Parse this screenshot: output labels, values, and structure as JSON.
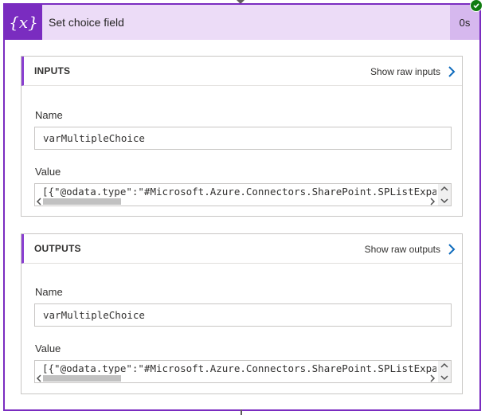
{
  "card": {
    "title": "Set choice field",
    "icon": "variable-icon",
    "icon_glyph": "{x}",
    "duration": "0s",
    "status": "succeeded"
  },
  "inputs": {
    "title": "INPUTS",
    "raw_link": "Show raw inputs",
    "name_label": "Name",
    "name_value": "varMultipleChoice",
    "value_label": "Value",
    "value_text": "[{\"@odata.type\":\"#Microsoft.Azure.Connectors.SharePoint.SPListExpan"
  },
  "outputs": {
    "title": "OUTPUTS",
    "raw_link": "Show raw outputs",
    "name_label": "Name",
    "name_value": "varMultipleChoice",
    "value_label": "Value",
    "value_text": "[{\"@odata.type\":\"#Microsoft.Azure.Connectors.SharePoint.SPListExpan"
  },
  "colors": {
    "accent_purple": "#7a2cc0",
    "header_bg": "#ecdcf7",
    "link_blue": "#0f6cbd",
    "success_green": "#107c10"
  }
}
